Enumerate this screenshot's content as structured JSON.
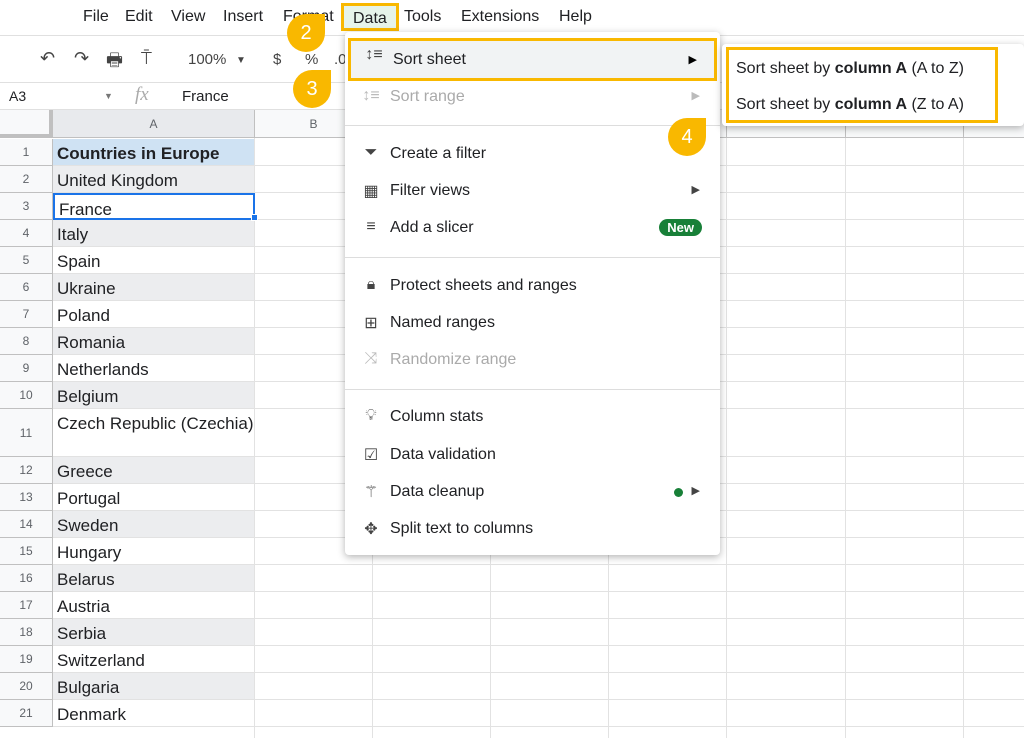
{
  "menubar": {
    "items": [
      "File",
      "Edit",
      "View",
      "Insert",
      "Format",
      "Data",
      "Tools",
      "Extensions",
      "Help"
    ]
  },
  "toolbar": {
    "zoom": "100%",
    "currency": "$",
    "percent": "%",
    "decimal": ".0"
  },
  "formula_bar": {
    "cell_ref": "A3",
    "fx": "fx",
    "value": "France"
  },
  "columns": [
    "A",
    "B"
  ],
  "rows": [
    "Countries in Europe",
    "United Kingdom",
    "France",
    "Italy",
    "Spain",
    "Ukraine",
    "Poland",
    "Romania",
    "Netherlands",
    "Belgium",
    "Czech Republic (Czechia)",
    "Greece",
    "Portugal",
    "Sweden",
    "Hungary",
    "Belarus",
    "Austria",
    "Serbia",
    "Switzerland",
    "Bulgaria",
    "Denmark"
  ],
  "row_numbers": [
    "1",
    "2",
    "3",
    "4",
    "5",
    "6",
    "7",
    "8",
    "9",
    "10",
    "11",
    "12",
    "13",
    "14",
    "15",
    "16",
    "17",
    "18",
    "19",
    "20",
    "21"
  ],
  "data_menu": {
    "sort_sheet": "Sort sheet",
    "sort_range": "Sort range",
    "create_filter": "Create a filter",
    "filter_views": "Filter views",
    "add_slicer": "Add a slicer",
    "new_badge": "New",
    "protect": "Protect sheets and ranges",
    "named_ranges": "Named ranges",
    "randomize": "Randomize range",
    "column_stats": "Column stats",
    "data_validation": "Data validation",
    "data_cleanup": "Data cleanup",
    "split_text": "Split text to columns"
  },
  "submenu": {
    "prefix": "Sort sheet by ",
    "bold": "column A",
    "az": " (A to Z)",
    "za": " (Z to A)"
  },
  "steps": [
    "2",
    "3",
    "4"
  ],
  "colors": {
    "highlight": "#f9b800",
    "new_badge": "#188038",
    "selection": "#1a73e8",
    "header_fill": "#cfe2f3"
  }
}
